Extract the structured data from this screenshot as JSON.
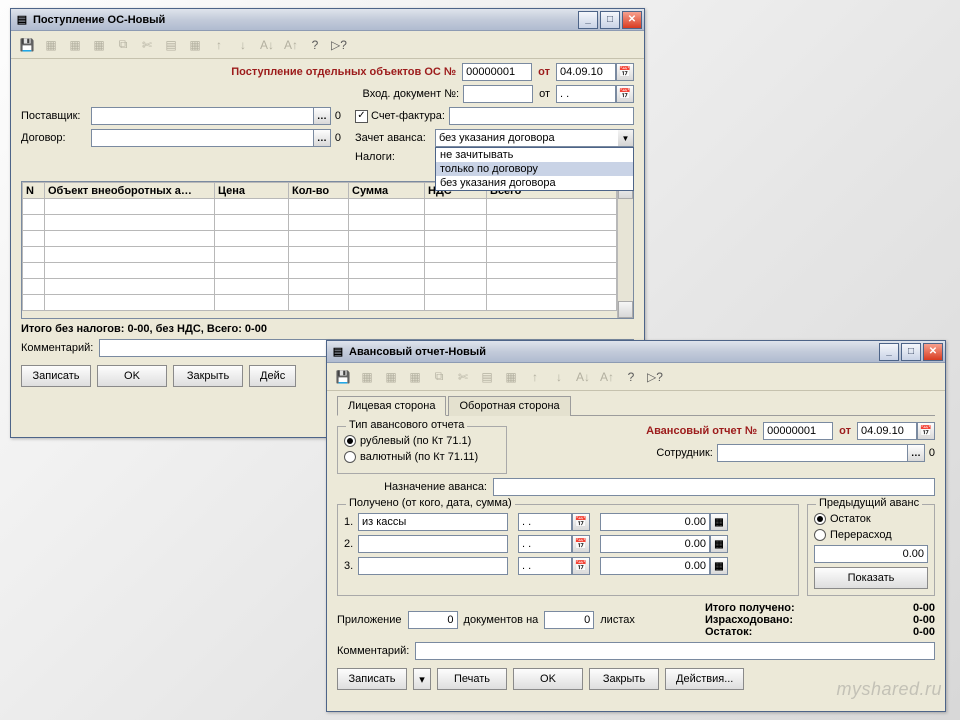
{
  "watermark": "myshared.ru",
  "win1": {
    "title": "Поступление ОС-Новый",
    "header": "Поступление отдельных объектов ОС №",
    "docnum": "00000001",
    "from": "от",
    "date": "04.09.10",
    "incoming_label": "Вход. документ №:",
    "incoming_from": "от",
    "incoming_date": ". .",
    "supplier_label": "Поставщик:",
    "contract_label": "Договор:",
    "zero": "0",
    "invoice_chk": "Счет-фактура:",
    "advance_label": "Зачет аванса:",
    "advance_value": "без указания договора",
    "advance_opts": [
      "не зачитывать",
      "только по договору",
      "без указания договора"
    ],
    "taxes_label": "Налоги:",
    "cols": {
      "n": "N",
      "obj": "Объект внеоборотных а…",
      "price": "Цена",
      "qty": "Кол-во",
      "sum": "Сумма",
      "vat": "НДС",
      "total": "Всего"
    },
    "totals_line": "Итого без налогов: 0-00, без НДС, Всего: 0-00",
    "comment_label": "Комментарий:",
    "btn_write": "Записать",
    "btn_ok": "OK",
    "btn_close": "Закрыть",
    "btn_actions": "Дейс"
  },
  "win2": {
    "title": "Авансовый отчет-Новый",
    "tab_front": "Лицевая сторона",
    "tab_back": "Оборотная сторона",
    "type_legend": "Тип авансового отчета",
    "type_rub": "рублевый (по Кт 71.1)",
    "type_val": "валютный (по Кт 71.11)",
    "header": "Авансовый отчет №",
    "docnum": "00000001",
    "from": "от",
    "date": "04.09.10",
    "employee_label": "Сотрудник:",
    "zero": "0",
    "purpose_label": "Назначение аванса:",
    "received_legend": "Получено (от кого, дата, сумма)",
    "r1_label": "1.",
    "r1_text": "из кассы",
    "r_date": ". .",
    "r_sum": "0.00",
    "r2_label": "2.",
    "r3_label": "3.",
    "prev_legend": "Предыдущий аванс",
    "prev_rest": "Остаток",
    "prev_over": "Перерасход",
    "prev_value": "0.00",
    "btn_show": "Показать",
    "attach_label": "Приложение",
    "attach_docs": "документов на",
    "attach_sheets": "листах",
    "attach_v1": "0",
    "attach_v2": "0",
    "sum_received": "Итого получено:",
    "sum_spent": "Израсходовано:",
    "sum_rest": "Остаток:",
    "sum_val": "0-00",
    "comment_label": "Комментарий:",
    "btn_write": "Записать",
    "btn_print": "Печать",
    "btn_ok": "OK",
    "btn_close": "Закрыть",
    "btn_actions": "Действия..."
  }
}
